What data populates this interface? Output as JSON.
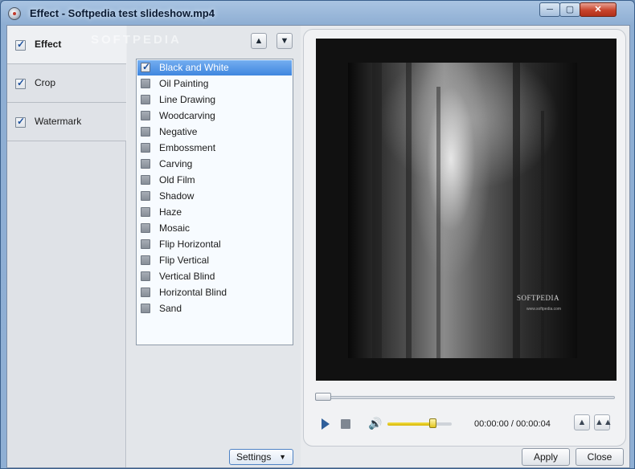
{
  "window": {
    "title": "Effect - Softpedia test slideshow.mp4",
    "controls": {
      "minimize": "─",
      "maximize": "▢",
      "close": "✕"
    }
  },
  "categories": [
    {
      "label": "Effect",
      "checked": true,
      "active": true
    },
    {
      "label": "Crop",
      "checked": true,
      "active": false
    },
    {
      "label": "Watermark",
      "checked": true,
      "active": false
    }
  ],
  "effect_list": {
    "move_up_icon": "▲",
    "move_down_icon": "▼",
    "items": [
      {
        "label": "Black and White",
        "checked": true,
        "selected": true
      },
      {
        "label": "Oil Painting",
        "checked": false
      },
      {
        "label": "Line Drawing",
        "checked": false
      },
      {
        "label": "Woodcarving",
        "checked": false
      },
      {
        "label": "Negative",
        "checked": false
      },
      {
        "label": "Embossment",
        "checked": false
      },
      {
        "label": "Carving",
        "checked": false
      },
      {
        "label": "Old Film",
        "checked": false
      },
      {
        "label": "Shadow",
        "checked": false
      },
      {
        "label": "Haze",
        "checked": false
      },
      {
        "label": "Mosaic",
        "checked": false
      },
      {
        "label": "Flip Horizontal",
        "checked": false
      },
      {
        "label": "Flip Vertical",
        "checked": false
      },
      {
        "label": "Vertical Blind",
        "checked": false
      },
      {
        "label": "Horizontal Blind",
        "checked": false
      },
      {
        "label": "Sand",
        "checked": false
      }
    ],
    "settings_label": "Settings",
    "settings_caret": "▼"
  },
  "preview": {
    "watermark_text": "SOFTPEDIA",
    "watermark_url": "www.softpedia.com",
    "seek_fraction": 0.0,
    "volume_fraction": 0.7,
    "time_display": "00:00:00 / 00:00:04",
    "volume_icon": "🔊",
    "snapshot_icon": "▲",
    "snapshot_multi_icon": "▲▲"
  },
  "screen_watermark": "SOFTPEDIA",
  "buttons": {
    "apply": "Apply",
    "close": "Close"
  },
  "colors": {
    "accent": "#3f86df",
    "selection_text": "#ffffff",
    "volume": "#d6b500"
  }
}
